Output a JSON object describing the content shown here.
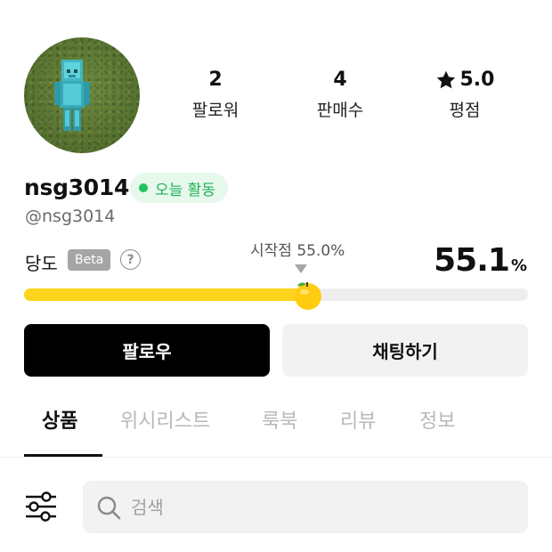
{
  "profile": {
    "username": "nsg3014",
    "handle": "@nsg3014",
    "activity_badge": "오늘 활동"
  },
  "stats": [
    {
      "value": "2",
      "label": "팔로워"
    },
    {
      "value": "4",
      "label": "판매수"
    },
    {
      "value": "5.0",
      "label": "평점",
      "icon": "star-icon"
    }
  ],
  "temperature": {
    "label": "당도",
    "beta": "Beta",
    "help": "?",
    "start_label": "시작점 55.0%",
    "value": "55.1",
    "unit": "%",
    "fill_percent": 55.1,
    "start_percent": 55.0
  },
  "buttons": {
    "follow": "팔로우",
    "chat": "채팅하기"
  },
  "tabs": [
    {
      "label": "상품",
      "active": true
    },
    {
      "label": "위시리스트",
      "active": false
    },
    {
      "label": "룩북",
      "active": false
    },
    {
      "label": "리뷰",
      "active": false
    },
    {
      "label": "정보",
      "active": false
    }
  ],
  "search": {
    "placeholder": "검색"
  },
  "colors": {
    "accent_yellow": "#ffd41c",
    "activity_green": "#22c35e",
    "follow_bg": "#000000"
  }
}
